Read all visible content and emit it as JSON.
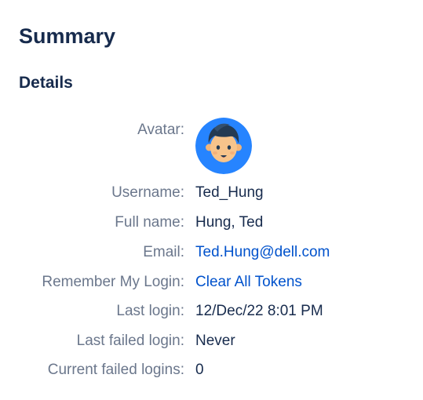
{
  "summary": {
    "title": "Summary"
  },
  "details": {
    "title": "Details",
    "avatar_label": "Avatar:",
    "username_label": "Username:",
    "username_value": "Ted_Hung",
    "fullname_label": "Full name:",
    "fullname_value": "Hung, Ted",
    "email_label": "Email:",
    "email_value": "Ted.Hung@dell.com",
    "remember_label": "Remember My Login:",
    "remember_value": "Clear All Tokens",
    "last_login_label": "Last login:",
    "last_login_value": "12/Dec/22 8:01 PM",
    "last_failed_label": "Last failed login:",
    "last_failed_value": "Never",
    "current_failed_label": "Current failed logins:",
    "current_failed_value": "0"
  },
  "avatar": {
    "icon": "user-avatar-icon",
    "background_color": "#2684ff",
    "hair_color": "#243b53",
    "skin_color": "#f7c48b"
  },
  "colors": {
    "heading": "#172b4d",
    "label": "#6b778c",
    "link": "#0052cc"
  }
}
